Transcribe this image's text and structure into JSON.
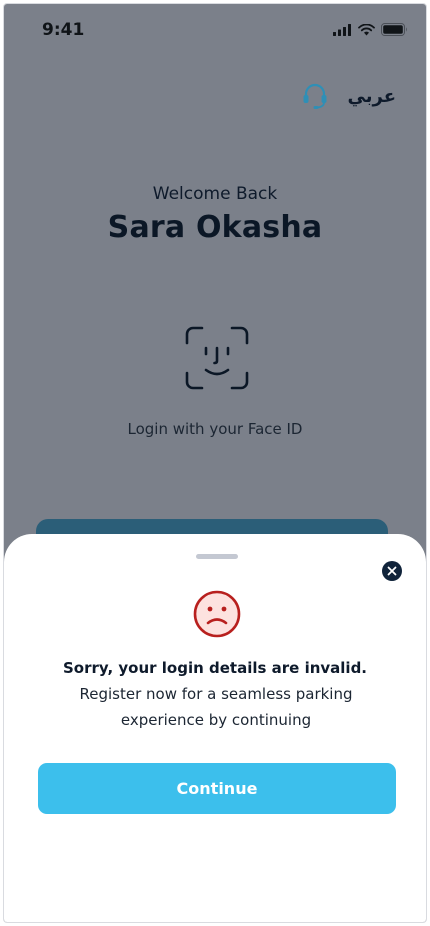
{
  "status_bar": {
    "time": "9:41",
    "icons": [
      "signal-icon",
      "wifi-icon",
      "battery-icon"
    ]
  },
  "header": {
    "language_toggle": "عربي",
    "support_icon": "headset-icon"
  },
  "login": {
    "greeting": "Welcome Back",
    "user_name": "Sara Okasha",
    "faceid_icon": "face-id-icon",
    "faceid_label": "Login with your Face ID"
  },
  "modal": {
    "close_icon": "close-icon",
    "status_icon": "sad-face-icon",
    "title": "Sorry, your login details are invalid.",
    "message": "Register now for a seamless parking experience by continuing",
    "continue_label": "Continue"
  },
  "colors": {
    "overlay_background": "#7b808a",
    "primary_dark": "#0e1a2b",
    "accent": "#3cbfec",
    "support_icon": "#2f8fb6",
    "error_red": "#b8201e",
    "error_face_fill": "#fde2df"
  }
}
